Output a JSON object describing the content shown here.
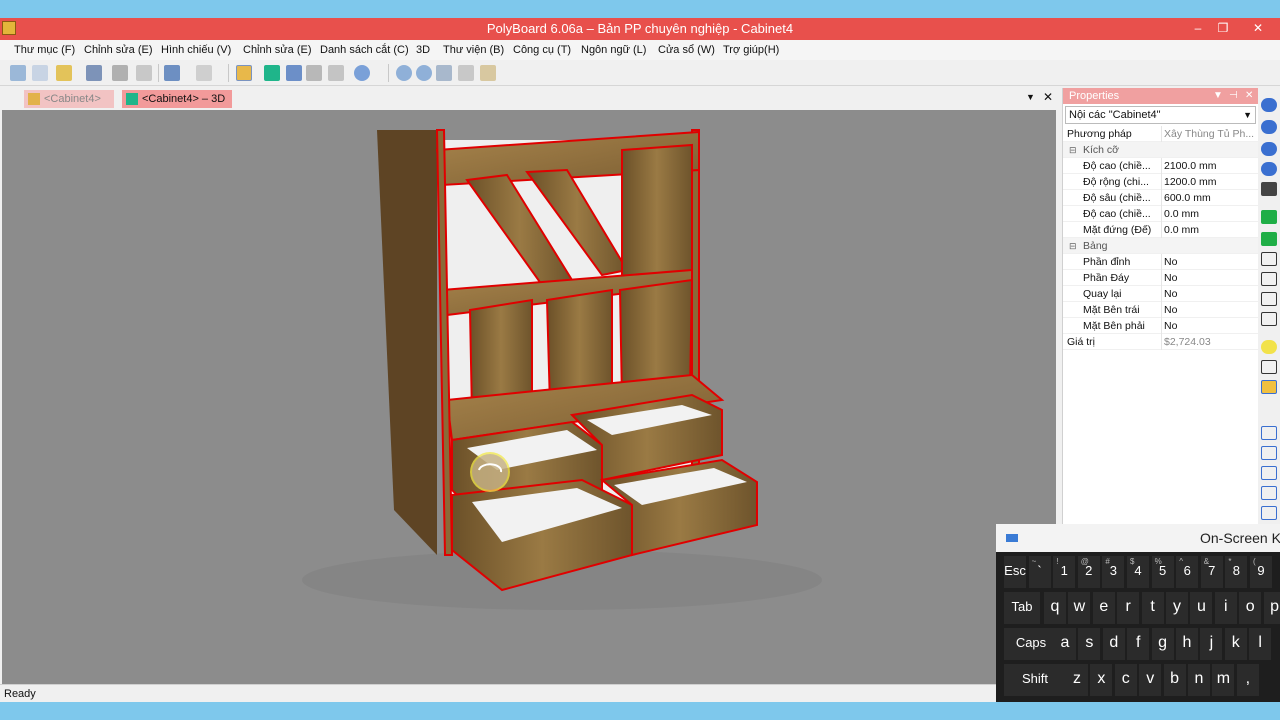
{
  "window": {
    "title": "PolyBoard 6.06a – Bản PP chuyên nghiệp - Cabinet4",
    "min": "–",
    "restore": "❐",
    "close": "✕"
  },
  "menu": [
    "Thư mục (F)",
    "Chỉnh sửa (E)",
    "Hình chiếu (V)",
    "Chỉnh sửa (E)",
    "Danh sách cắt (C)",
    "3D",
    "Thư viện (B)",
    "Công cụ (T)",
    "Ngôn ngữ (L)",
    "Cửa sổ (W)",
    "Trợ giúp(H)"
  ],
  "tabs": {
    "tab1": "<Cabinet4>",
    "tab2": "<Cabinet4> – 3D",
    "dropdown": "▼",
    "close": "✕"
  },
  "status": "Ready",
  "properties": {
    "header": "Properties",
    "selector": "Nội các \"Cabinet4\"",
    "method_key": "Phương pháp",
    "method_val": "Xây Thùng Tủ Ph...",
    "group_size": "Kích cỡ",
    "rows_size": [
      {
        "k": "Độ cao (chiề...",
        "v": "2100.0 mm"
      },
      {
        "k": "Độ rộng (chi...",
        "v": "1200.0 mm"
      },
      {
        "k": "Độ sâu (chiề...",
        "v": "600.0 mm"
      },
      {
        "k": "Độ cao (chiề...",
        "v": "0.0 mm"
      },
      {
        "k": "Mặt đứng (Đế)",
        "v": "0.0 mm"
      }
    ],
    "group_board": "Bảng",
    "rows_board": [
      {
        "k": "Phần đỉnh",
        "v": "No"
      },
      {
        "k": "Phần Đáy",
        "v": "No"
      },
      {
        "k": "Quay lại",
        "v": "No"
      },
      {
        "k": "Mặt Bên trái",
        "v": "No"
      },
      {
        "k": "Mặt Bên phải",
        "v": "No"
      }
    ],
    "value_key": "Giá trị",
    "value_val": "$2,724.03"
  },
  "keyboard": {
    "title": "On-Screen Ke",
    "row1": [
      {
        "sub": "",
        "main": "Esc"
      },
      {
        "sub": "~",
        "main": "`"
      },
      {
        "sub": "!",
        "main": "1"
      },
      {
        "sub": "@",
        "main": "2"
      },
      {
        "sub": "#",
        "main": "3"
      },
      {
        "sub": "$",
        "main": "4"
      },
      {
        "sub": "%",
        "main": "5"
      },
      {
        "sub": "^",
        "main": "6"
      },
      {
        "sub": "&",
        "main": "7"
      },
      {
        "sub": "*",
        "main": "8"
      },
      {
        "sub": "(",
        "main": "9"
      }
    ],
    "row2": [
      "Tab",
      "q",
      "w",
      "e",
      "r",
      "t",
      "y",
      "u",
      "i",
      "o",
      "p"
    ],
    "row3": [
      "Caps",
      "a",
      "s",
      "d",
      "f",
      "g",
      "h",
      "j",
      "k",
      "l"
    ],
    "row4": [
      "Shift",
      "z",
      "x",
      "c",
      "v",
      "b",
      "n",
      "m",
      ","
    ]
  },
  "colors": {
    "titlebar": "#e8504c",
    "selection_edge": "#e00000",
    "wood": "#8a6a38",
    "viewport_bg": "#8c8c8c"
  }
}
